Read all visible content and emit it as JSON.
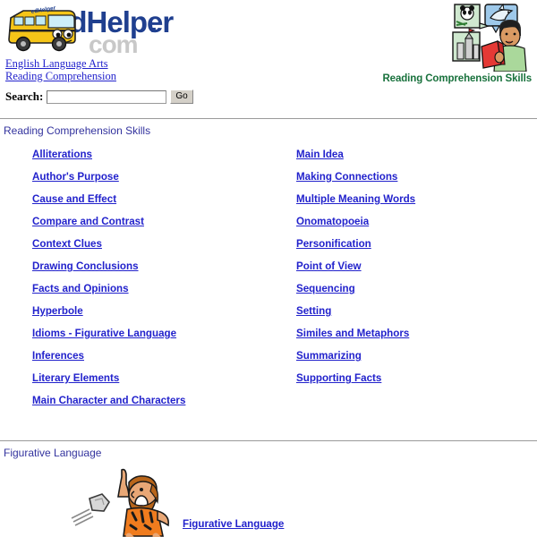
{
  "site": {
    "logo_text_main": "edHelper",
    "logo_text_dot": ".",
    "logo_text_com": "com",
    "logo_bus_label": "edHelper"
  },
  "breadcrumb": {
    "items": [
      {
        "label": "English Language Arts"
      },
      {
        "label": "Reading Comprehension"
      }
    ]
  },
  "search": {
    "label": "Search:",
    "value": "",
    "placeholder": "",
    "button_label": "Go"
  },
  "hero": {
    "caption": "Reading Comprehension Skills",
    "caption_color": "#18713c"
  },
  "sections": [
    {
      "title": "Reading Comprehension Skills",
      "links": [
        {
          "label": "Alliterations"
        },
        {
          "label": "Author's Purpose"
        },
        {
          "label": "Cause and Effect"
        },
        {
          "label": "Compare and Contrast"
        },
        {
          "label": "Context Clues"
        },
        {
          "label": "Drawing Conclusions"
        },
        {
          "label": "Facts and Opinions"
        },
        {
          "label": "Hyperbole"
        },
        {
          "label": "Idioms - Figurative Language"
        },
        {
          "label": "Inferences"
        },
        {
          "label": "Literary Elements"
        },
        {
          "label": "Main Character and Characters"
        },
        {
          "label": "Main Idea"
        },
        {
          "label": "Making Connections"
        },
        {
          "label": "Multiple Meaning Words"
        },
        {
          "label": "Onomatopoeia"
        },
        {
          "label": "Personification"
        },
        {
          "label": "Point of View"
        },
        {
          "label": "Sequencing"
        },
        {
          "label": "Setting"
        },
        {
          "label": "Similes and Metaphors"
        },
        {
          "label": "Summarizing"
        },
        {
          "label": "Supporting Facts"
        }
      ]
    }
  ],
  "figurative": {
    "title": "Figurative Language",
    "link_label": "Figurative Language"
  },
  "colors": {
    "link": "#2222cc",
    "section_heading": "#33339e",
    "rule": "#9a9a9a"
  }
}
